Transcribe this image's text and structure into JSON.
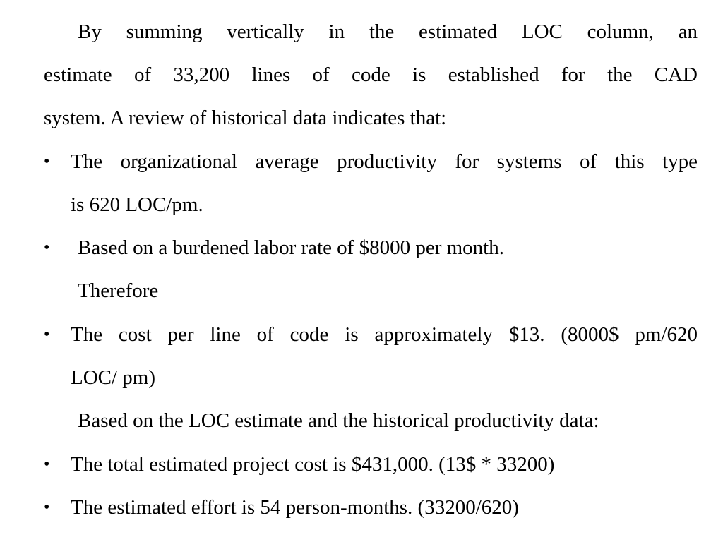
{
  "paragraph1": {
    "lines": [
      "By summing vertically in the estimated LOC column, an",
      "estimate of 33,200 lines of code is established for the CAD",
      "system. A review of historical data indicates that:"
    ]
  },
  "bullet_glyph": "•",
  "bullet1": {
    "lines": [
      "The organizational average productivity for systems of this type",
      "is 620 LOC/pm."
    ]
  },
  "bullet2": {
    "lines": [
      "Based on a burdened labor rate of $8000 per month."
    ]
  },
  "therefore": "Therefore",
  "bullet3": {
    "lines": [
      "The cost per line of code is approximately $13. (8000$ pm/620",
      "LOC/ pm)"
    ]
  },
  "based_on": "Based on the LOC estimate and the historical productivity data:",
  "bullet4": {
    "lines": [
      "The total estimated project cost is $431,000.  (13$ * 33200)"
    ]
  },
  "bullet5": {
    "lines": [
      "The estimated effort is 54 person-months.  (33200/620)"
    ]
  }
}
